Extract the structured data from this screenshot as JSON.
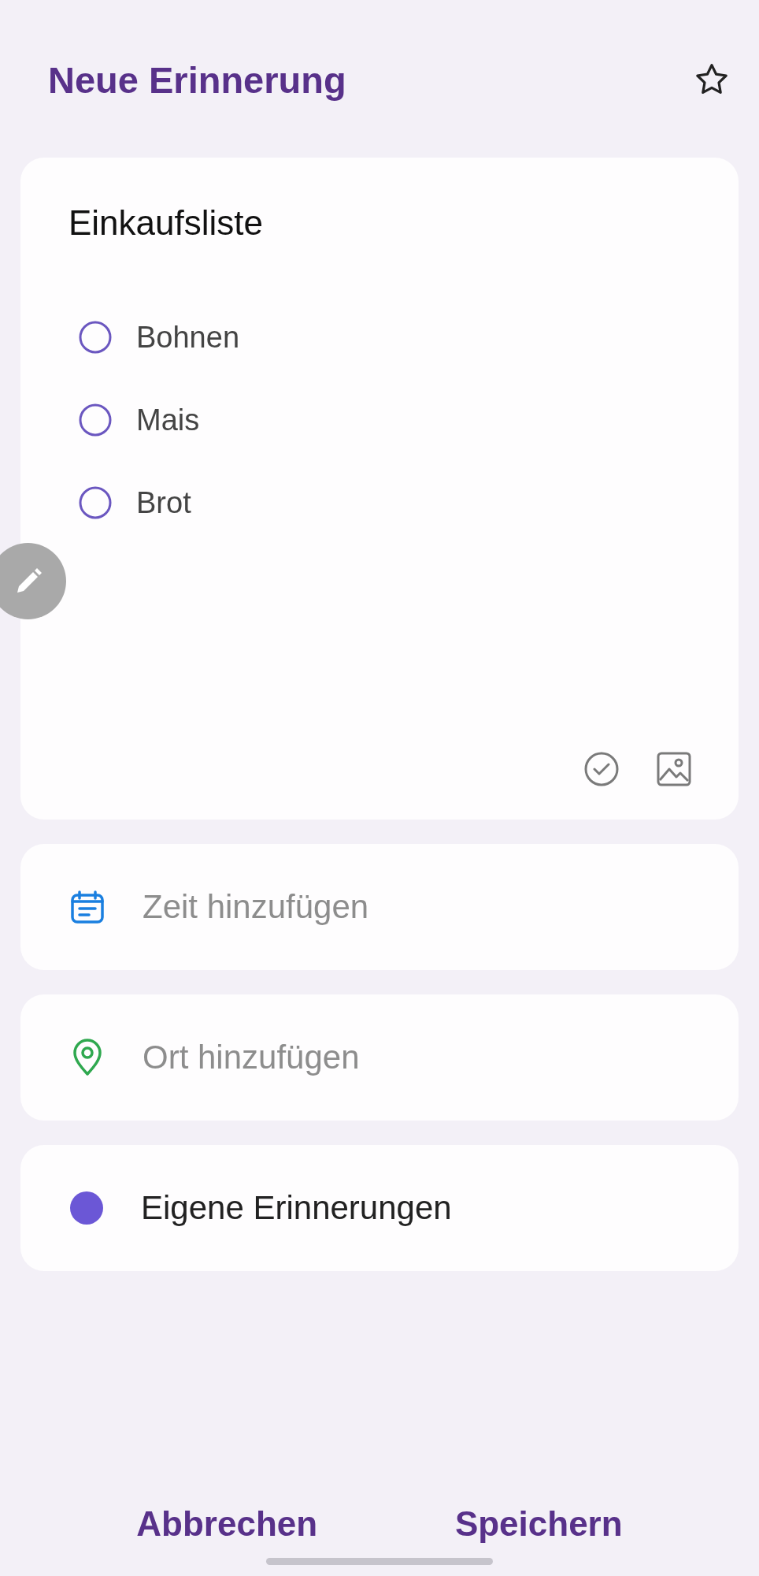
{
  "header": {
    "title": "Neue Erinnerung",
    "starred": false
  },
  "note": {
    "title": "Einkaufsliste",
    "items": [
      {
        "text": "Bohnen",
        "checked": false
      },
      {
        "text": "Mais",
        "checked": false
      },
      {
        "text": "Brot",
        "checked": false
      }
    ]
  },
  "fields": [
    {
      "kind": "time",
      "placeholder": "Zeit hinzufügen"
    },
    {
      "kind": "location",
      "placeholder": "Ort hinzufügen"
    },
    {
      "kind": "category",
      "value": "Eigene Erinnerungen",
      "color": "#6b57d6"
    }
  ],
  "buttons": [
    "Abbrechen",
    "Speichern"
  ]
}
